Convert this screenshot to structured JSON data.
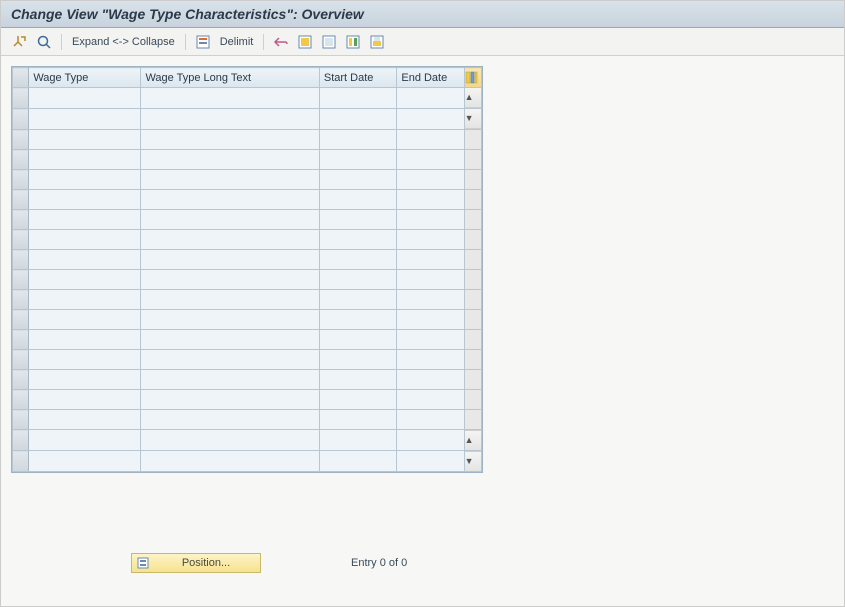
{
  "title": "Change View \"Wage Type Characteristics\": Overview",
  "toolbar": {
    "expand_collapse": "Expand <-> Collapse",
    "delimit": "Delimit"
  },
  "table": {
    "headers": {
      "wage_type": "Wage Type",
      "wage_type_text": "Wage Type Long Text",
      "start_date": "Start Date",
      "end_date": "End Date"
    },
    "rows": [
      {
        "wage_type": "",
        "wage_type_text": "",
        "start_date": "",
        "end_date": ""
      },
      {
        "wage_type": "",
        "wage_type_text": "",
        "start_date": "",
        "end_date": ""
      },
      {
        "wage_type": "",
        "wage_type_text": "",
        "start_date": "",
        "end_date": ""
      },
      {
        "wage_type": "",
        "wage_type_text": "",
        "start_date": "",
        "end_date": ""
      },
      {
        "wage_type": "",
        "wage_type_text": "",
        "start_date": "",
        "end_date": ""
      },
      {
        "wage_type": "",
        "wage_type_text": "",
        "start_date": "",
        "end_date": ""
      },
      {
        "wage_type": "",
        "wage_type_text": "",
        "start_date": "",
        "end_date": ""
      },
      {
        "wage_type": "",
        "wage_type_text": "",
        "start_date": "",
        "end_date": ""
      },
      {
        "wage_type": "",
        "wage_type_text": "",
        "start_date": "",
        "end_date": ""
      },
      {
        "wage_type": "",
        "wage_type_text": "",
        "start_date": "",
        "end_date": ""
      },
      {
        "wage_type": "",
        "wage_type_text": "",
        "start_date": "",
        "end_date": ""
      },
      {
        "wage_type": "",
        "wage_type_text": "",
        "start_date": "",
        "end_date": ""
      },
      {
        "wage_type": "",
        "wage_type_text": "",
        "start_date": "",
        "end_date": ""
      },
      {
        "wage_type": "",
        "wage_type_text": "",
        "start_date": "",
        "end_date": ""
      },
      {
        "wage_type": "",
        "wage_type_text": "",
        "start_date": "",
        "end_date": ""
      },
      {
        "wage_type": "",
        "wage_type_text": "",
        "start_date": "",
        "end_date": ""
      },
      {
        "wage_type": "",
        "wage_type_text": "",
        "start_date": "",
        "end_date": ""
      },
      {
        "wage_type": "",
        "wage_type_text": "",
        "start_date": "",
        "end_date": ""
      },
      {
        "wage_type": "",
        "wage_type_text": "",
        "start_date": "",
        "end_date": ""
      }
    ]
  },
  "footer": {
    "position_label": "Position...",
    "entry_text": "Entry 0 of 0"
  }
}
